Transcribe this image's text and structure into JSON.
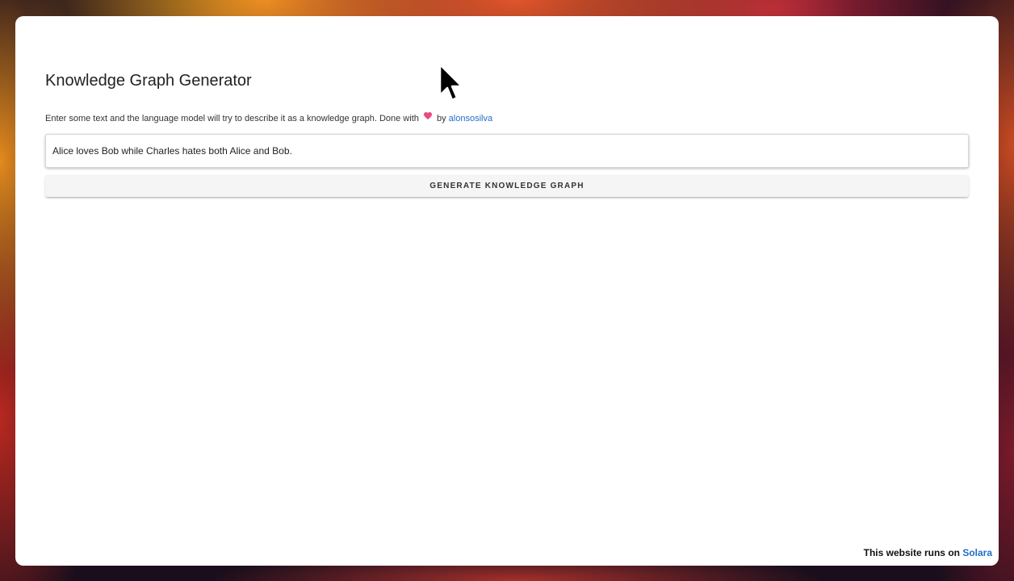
{
  "app": {
    "title": "Knowledge Graph Generator",
    "description_before": "Enter some text and the language model will try to describe it as a knowledge graph. Done with ",
    "description_by": " by ",
    "author_link": "alonsosilva"
  },
  "input": {
    "value": "Alice loves Bob while Charles hates both Alice and Bob."
  },
  "actions": {
    "generate_label": "Generate Knowledge Graph"
  },
  "footer": {
    "prefix": "This website runs on ",
    "link": "Solara"
  },
  "colors": {
    "heart": "#e64c7f",
    "link": "#1f6fc5"
  },
  "icons": {
    "heart": "heart-icon",
    "cursor": "mouse-cursor-icon"
  }
}
